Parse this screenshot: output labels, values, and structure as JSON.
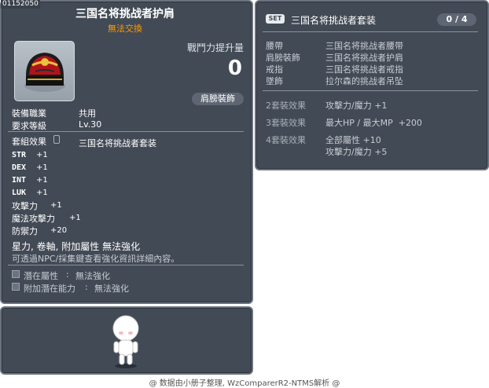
{
  "item": {
    "id": "01152050",
    "name": "三国名将挑战者护肩",
    "trade_status": "無法交換",
    "attack_increase_label": "戰鬥力提升量",
    "attack_increase_value": "0",
    "slot_badge": "肩膀裝飾",
    "job_label": "裝備職業",
    "job_value": "共用",
    "level_label": "要求等級",
    "level_value": "Lv.30",
    "set_effect_label": "套組效果",
    "set_name": "三国名将挑战者套装",
    "stats": [
      {
        "name": "STR",
        "value": "+1"
      },
      {
        "name": "DEX",
        "value": "+1"
      },
      {
        "name": "INT",
        "value": "+1"
      },
      {
        "name": "LUK",
        "value": "+1"
      },
      {
        "name": "攻擊力",
        "value": "+1"
      },
      {
        "name": "魔法攻擊力",
        "value": "+1"
      },
      {
        "name": "防禦力",
        "value": "+20"
      }
    ],
    "restrictions": "星力, 卷軸, 附加屬性 無法強化",
    "info_note": "可透過NPC/採集鍵查看強化資訊詳細內容。",
    "potential_label": "潛在屬性",
    "potential_value": "無法強化",
    "bonus_potential_label": "附加潛在能力",
    "bonus_potential_value": "無法強化",
    "colon": ":"
  },
  "set_panel": {
    "badge": "SET",
    "title": "三国名将挑战者套装",
    "count": "0 / 4",
    "parts": [
      {
        "slot": "腰帶",
        "item": "三国名将挑战者腰带"
      },
      {
        "slot": "肩膀裝飾",
        "item": "三国名将挑战者护肩"
      },
      {
        "slot": "戒指",
        "item": "三国名将挑战者戒指"
      },
      {
        "slot": "墜飾",
        "item": "拉尔森的挑战者吊坠"
      }
    ],
    "effects": [
      {
        "label": "2套裝效果",
        "lines": [
          "攻擊力/魔力 +1"
        ]
      },
      {
        "label": "3套裝效果",
        "lines": [
          "最大HP / 最大MP  +200"
        ]
      },
      {
        "label": "4套裝效果",
        "lines": [
          "全部屬性 +10",
          "攻擊力/魔力 +5"
        ]
      }
    ]
  },
  "footer": "@ 数据由小册子整理, WzComparerR2-NTMS解析 @",
  "colors": {
    "panel_bg": "#424a55",
    "panel_border": "#6a737e",
    "trade_status": "#ff9900",
    "muted_text": "#c8cdd3"
  },
  "icons": [
    "helmet-item-icon",
    "lock-icon",
    "set-badge-icon",
    "character-avatar"
  ]
}
